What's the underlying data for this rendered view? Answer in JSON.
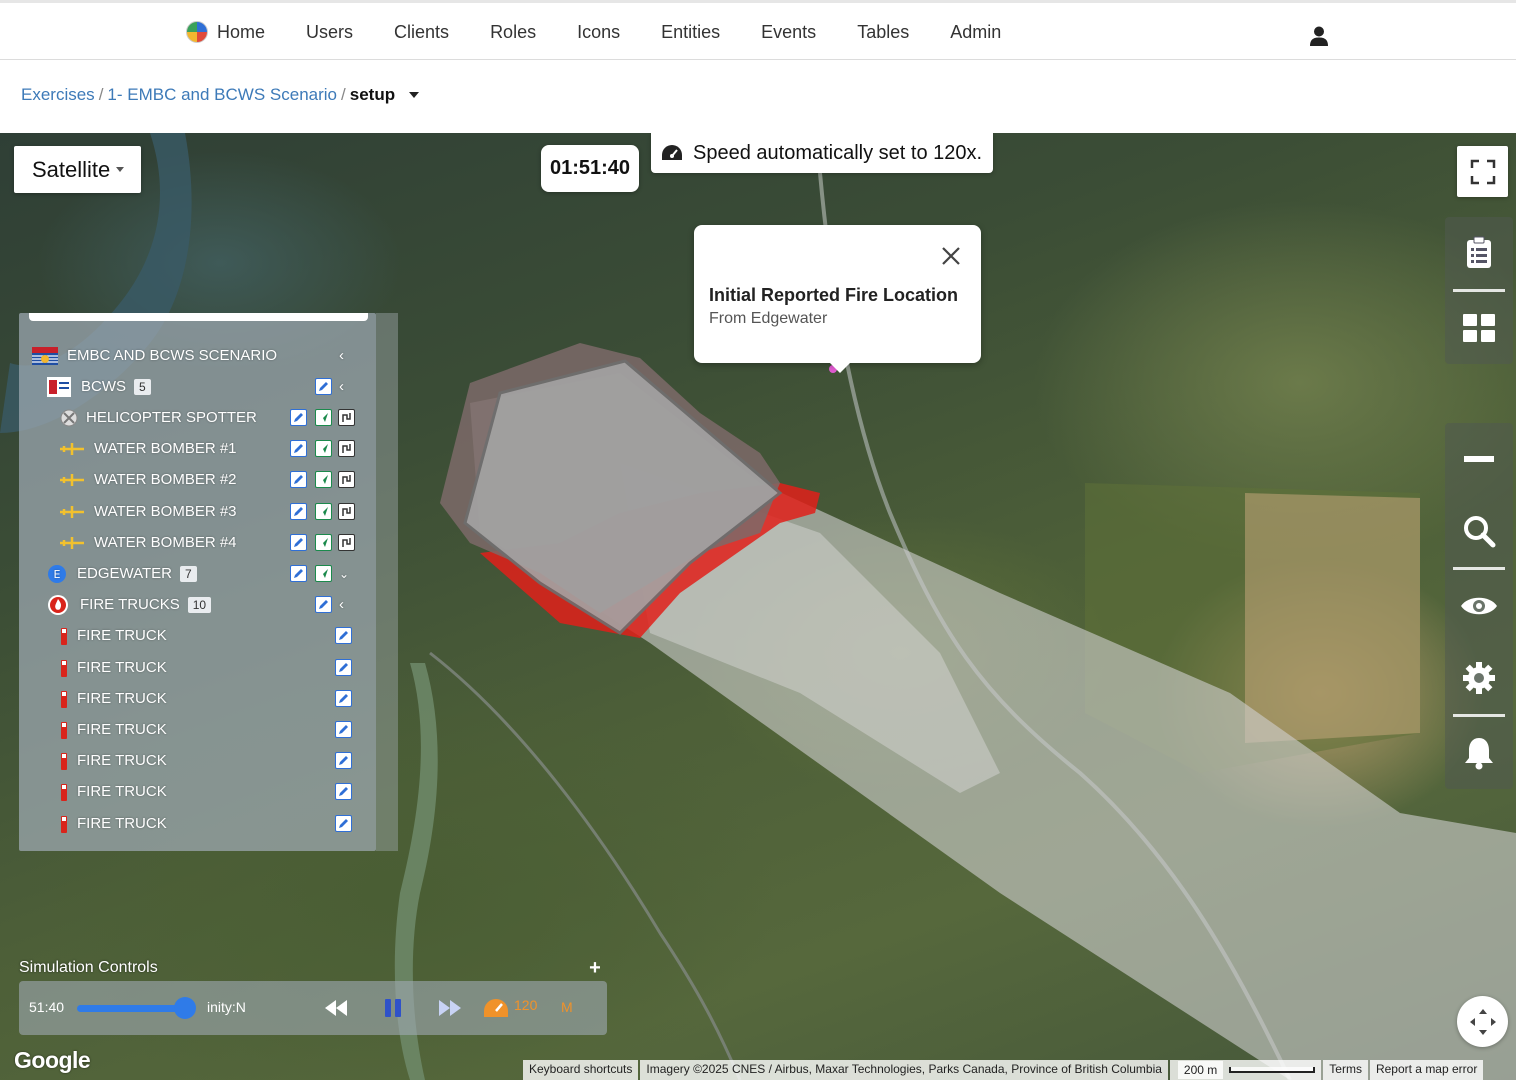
{
  "nav": {
    "items": [
      "Home",
      "Users",
      "Clients",
      "Roles",
      "Icons",
      "Entities",
      "Events",
      "Tables",
      "Admin"
    ]
  },
  "breadcrumb": {
    "items": [
      "Exercises",
      "1- EMBC and BCWS Scenario"
    ],
    "current": "setup"
  },
  "map": {
    "type_label": "Satellite",
    "clock": "01:51:40",
    "speed_message": "Speed automatically set to 120x.",
    "popup": {
      "title": "Initial Reported Fire Location",
      "subtitle": "From Edgewater"
    },
    "fire_colors": {
      "fire": "#e0201a",
      "smoke": "#c8c8c8"
    }
  },
  "layers": {
    "root": {
      "label": "EMBC AND BCWS SCENARIO"
    },
    "groups": [
      {
        "label": "BCWS",
        "count": "5"
      },
      {
        "label": "EDGEWATER",
        "count": "7"
      },
      {
        "label": "FIRE TRUCKS",
        "count": "10"
      }
    ],
    "bcws_items": [
      "HELICOPTER SPOTTER",
      "WATER BOMBER #1",
      "WATER BOMBER #2",
      "WATER BOMBER #3",
      "WATER BOMBER #4"
    ],
    "truck_items": [
      "FIRE TRUCK",
      "FIRE TRUCK",
      "FIRE TRUCK",
      "FIRE TRUCK",
      "FIRE TRUCK",
      "FIRE TRUCK",
      "FIRE TRUCK"
    ]
  },
  "sim": {
    "title": "Simulation Controls",
    "time": "51:40",
    "infinity": "inity:N",
    "speed": "120",
    "mode": "M"
  },
  "attribution": {
    "keyboard": "Keyboard shortcuts",
    "imagery": "Imagery ©2025 CNES / Airbus, Maxar Technologies, Parks Canada, Province of British Columbia",
    "scale": "200 m",
    "terms": "Terms",
    "report": "Report a map error"
  },
  "google_logo": "Google"
}
